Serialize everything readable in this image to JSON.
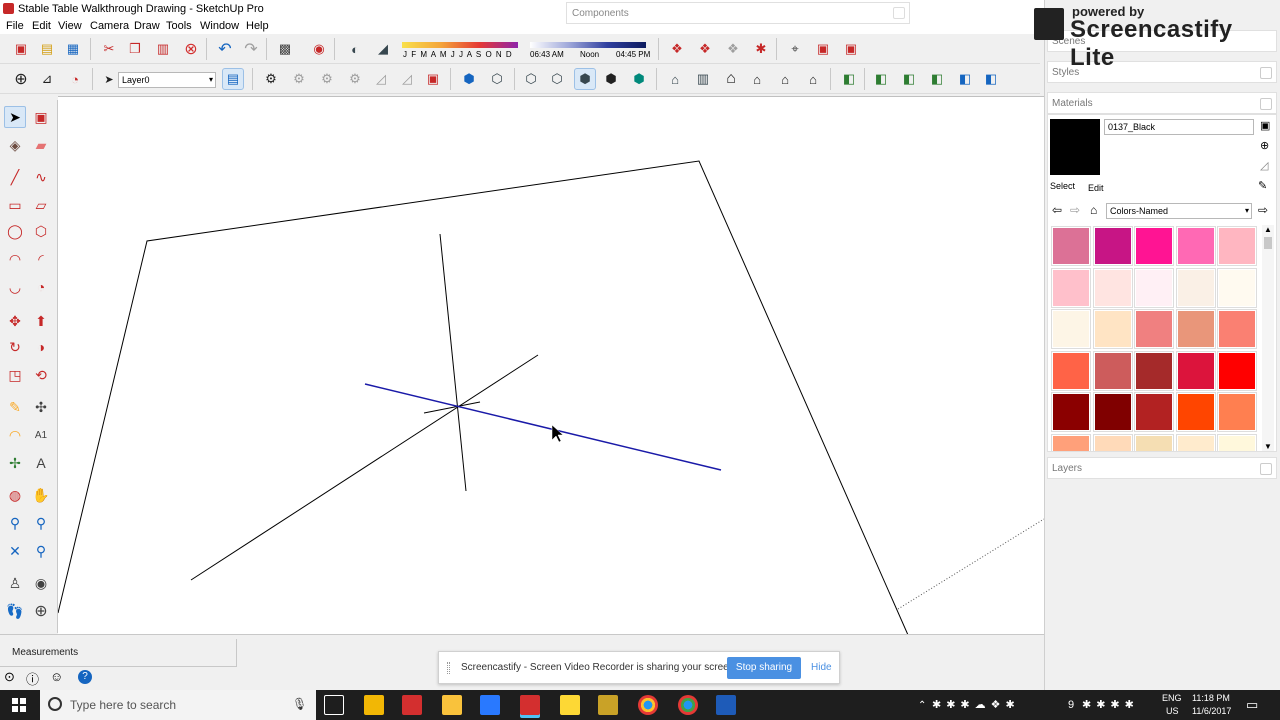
{
  "window": {
    "title": "Stable Table Walkthrough Drawing - SketchUp Pro"
  },
  "menu": [
    "File",
    "Edit",
    "View",
    "Camera",
    "Draw",
    "Tools",
    "Window",
    "Help"
  ],
  "toolbar": {
    "months": "J F M A M J J A S O N D",
    "time_start": "06:43 AM",
    "time_noon": "Noon",
    "time_end": "04:45 PM",
    "layer_selected": "Layer0"
  },
  "panels": {
    "components_title": "Components",
    "scenes_title": "Scenes",
    "styles_title": "Styles",
    "materials_title": "Materials",
    "layers_title": "Layers"
  },
  "materials": {
    "current_name": "0137_Black",
    "current_color": "#000000",
    "tab_select": "Select",
    "tab_edit": "Edit",
    "library": "Colors-Named",
    "swatches": [
      "#dc7196",
      "#c71585",
      "#ff1493",
      "#ff69b4",
      "#ffb6c1",
      "#ffc0cb",
      "#ffe4e1",
      "#fff0f5",
      "#faf0e6",
      "#fffaf0",
      "#fdf5e6",
      "#ffe4c4",
      "#f08080",
      "#e9967a",
      "#fa8072",
      "#ff6347",
      "#cd5c5c",
      "#a52a2a",
      "#dc143c",
      "#ff0000",
      "#8b0000",
      "#800000",
      "#b22222",
      "#ff4500",
      "#ff7f50",
      "#ffa07a",
      "#ffdab9",
      "#f5deb3",
      "#ffebcd",
      "#fff8dc"
    ]
  },
  "status": {
    "measurements": "Measurements"
  },
  "share_banner": {
    "message": "Screencastify - Screen Video Recorder is sharing your screen.",
    "stop": "Stop sharing",
    "hide": "Hide"
  },
  "watermark": {
    "line1": "powered by",
    "line2": "Screencastify Lite"
  },
  "taskbar": {
    "search_placeholder": "Type here to search",
    "lang": "ENG",
    "region": "US",
    "time": "11:18 PM",
    "date": "11/6/2017",
    "badge": "9"
  },
  "colors": {
    "accent_blue": "#1a1aa8",
    "axis_black": "#000000"
  }
}
